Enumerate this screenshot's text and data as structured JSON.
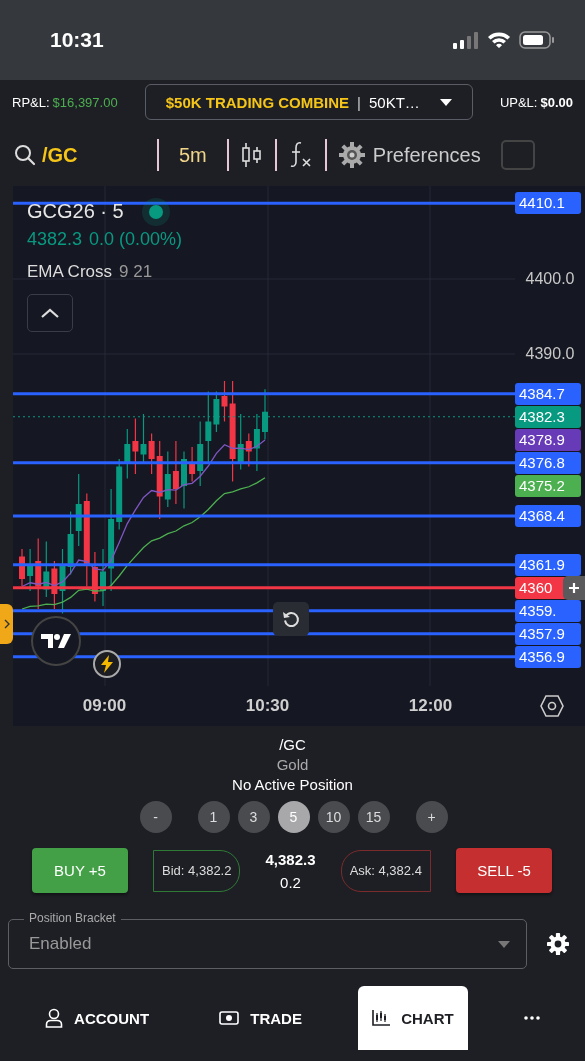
{
  "status_bar": {
    "time": "10:31"
  },
  "account_bar": {
    "rpl_label": "RP&L:",
    "rpl_value": "$16,397.00",
    "account_name": "$50K TRADING COMBINE",
    "separator": "|",
    "account_id": "50KT…",
    "upl_label": "UP&L:",
    "upl_value": "$0.00"
  },
  "toolbar": {
    "symbol": "/GC",
    "interval": "5m",
    "preferences": "Preferences",
    "toggle_checked": false
  },
  "chart": {
    "title": "GCG26 · 5",
    "quote": "4382.3",
    "change": "0.0 (0.00%)",
    "indicator_name": "EMA Cross",
    "indicator_params": "9 21",
    "price_ticks": [
      "4400.0",
      "4390.0"
    ],
    "price_lines": [
      {
        "label": "4410.1",
        "kind": "order",
        "color": "#2962ff"
      },
      {
        "label": "4384.7",
        "kind": "order",
        "color": "#2962ff"
      },
      {
        "label": "4382.3",
        "kind": "last",
        "color": "#089981"
      },
      {
        "label": "4378.9",
        "kind": "ema",
        "color": "#673ab7"
      },
      {
        "label": "4376.8",
        "kind": "order",
        "color": "#2962ff"
      },
      {
        "label": "4375.2",
        "kind": "ema",
        "color": "#4caf50"
      },
      {
        "label": "4368.4",
        "kind": "order",
        "color": "#2962ff"
      },
      {
        "label": "4361.9",
        "kind": "order",
        "color": "#2962ff"
      },
      {
        "label": "4360",
        "kind": "order",
        "color": "#f23645"
      },
      {
        "label": "4359.",
        "kind": "order",
        "color": "#2962ff"
      },
      {
        "label": "4357.9",
        "kind": "order",
        "color": "#2962ff"
      },
      {
        "label": "4356.9",
        "kind": "order",
        "color": "#2962ff"
      }
    ],
    "time_ticks": [
      "09:00",
      "10:30",
      "12:00"
    ]
  },
  "instrument": {
    "symbol": "/GC",
    "name": "Gold",
    "position": "No Active Position"
  },
  "quantity": {
    "decrease": "-",
    "increase": "+",
    "options": [
      {
        "label": "1",
        "selected": false
      },
      {
        "label": "3",
        "selected": false
      },
      {
        "label": "5",
        "selected": true
      },
      {
        "label": "10",
        "selected": false
      },
      {
        "label": "15",
        "selected": false
      }
    ]
  },
  "trade": {
    "buy": "BUY +5",
    "bid": "Bid: 4,382.2",
    "last": "4,382.3",
    "spread": "0.2",
    "ask": "Ask: 4,382.4",
    "sell": "SELL -5"
  },
  "position_bracket": {
    "label": "Position Bracket",
    "value": "Enabled"
  },
  "nav": [
    {
      "label": "ACCOUNT",
      "kind": "account",
      "selected": false
    },
    {
      "label": "TRADE",
      "kind": "trade",
      "selected": false
    },
    {
      "label": "CHART",
      "kind": "chart",
      "selected": true
    },
    {
      "kind": "more",
      "selected": false
    }
  ]
}
